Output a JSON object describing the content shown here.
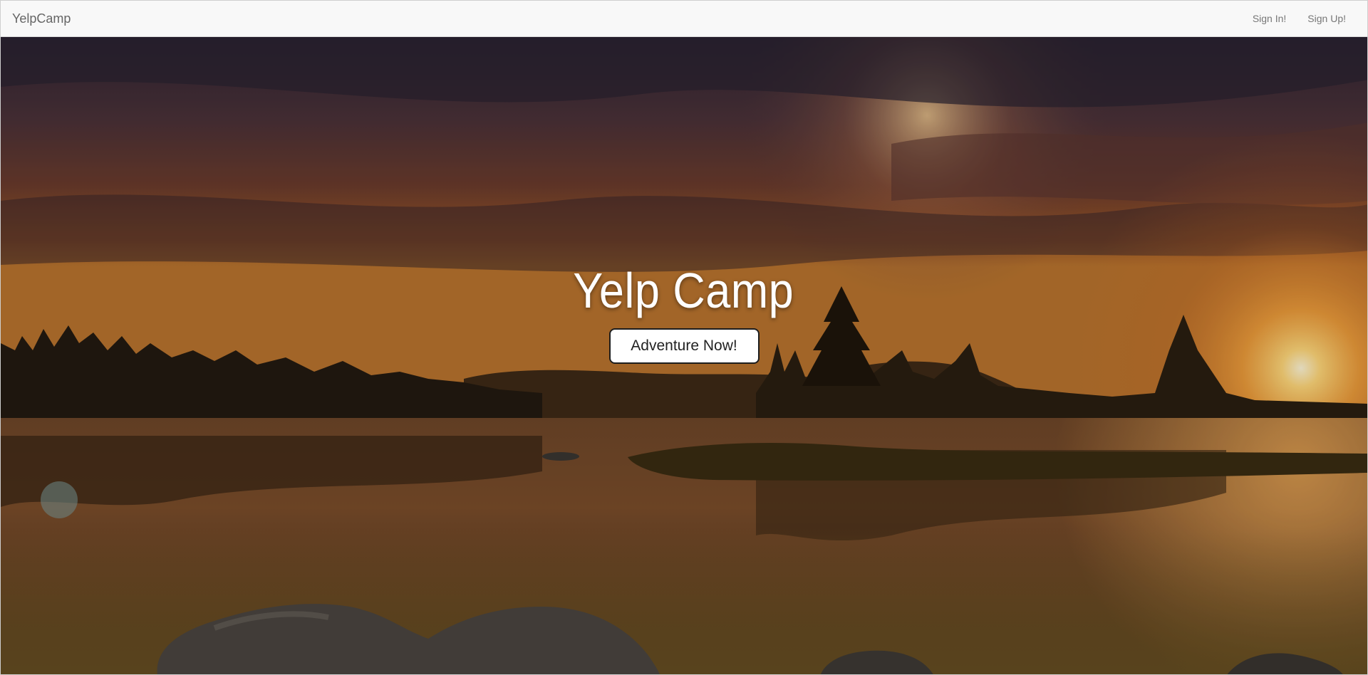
{
  "navbar": {
    "brand": "YelpCamp",
    "links": [
      {
        "label": "Sign In!"
      },
      {
        "label": "Sign Up!"
      }
    ]
  },
  "hero": {
    "title": "Yelp Camp",
    "button_label": "Adventure Now!",
    "background": "sunset-lake-landscape"
  }
}
